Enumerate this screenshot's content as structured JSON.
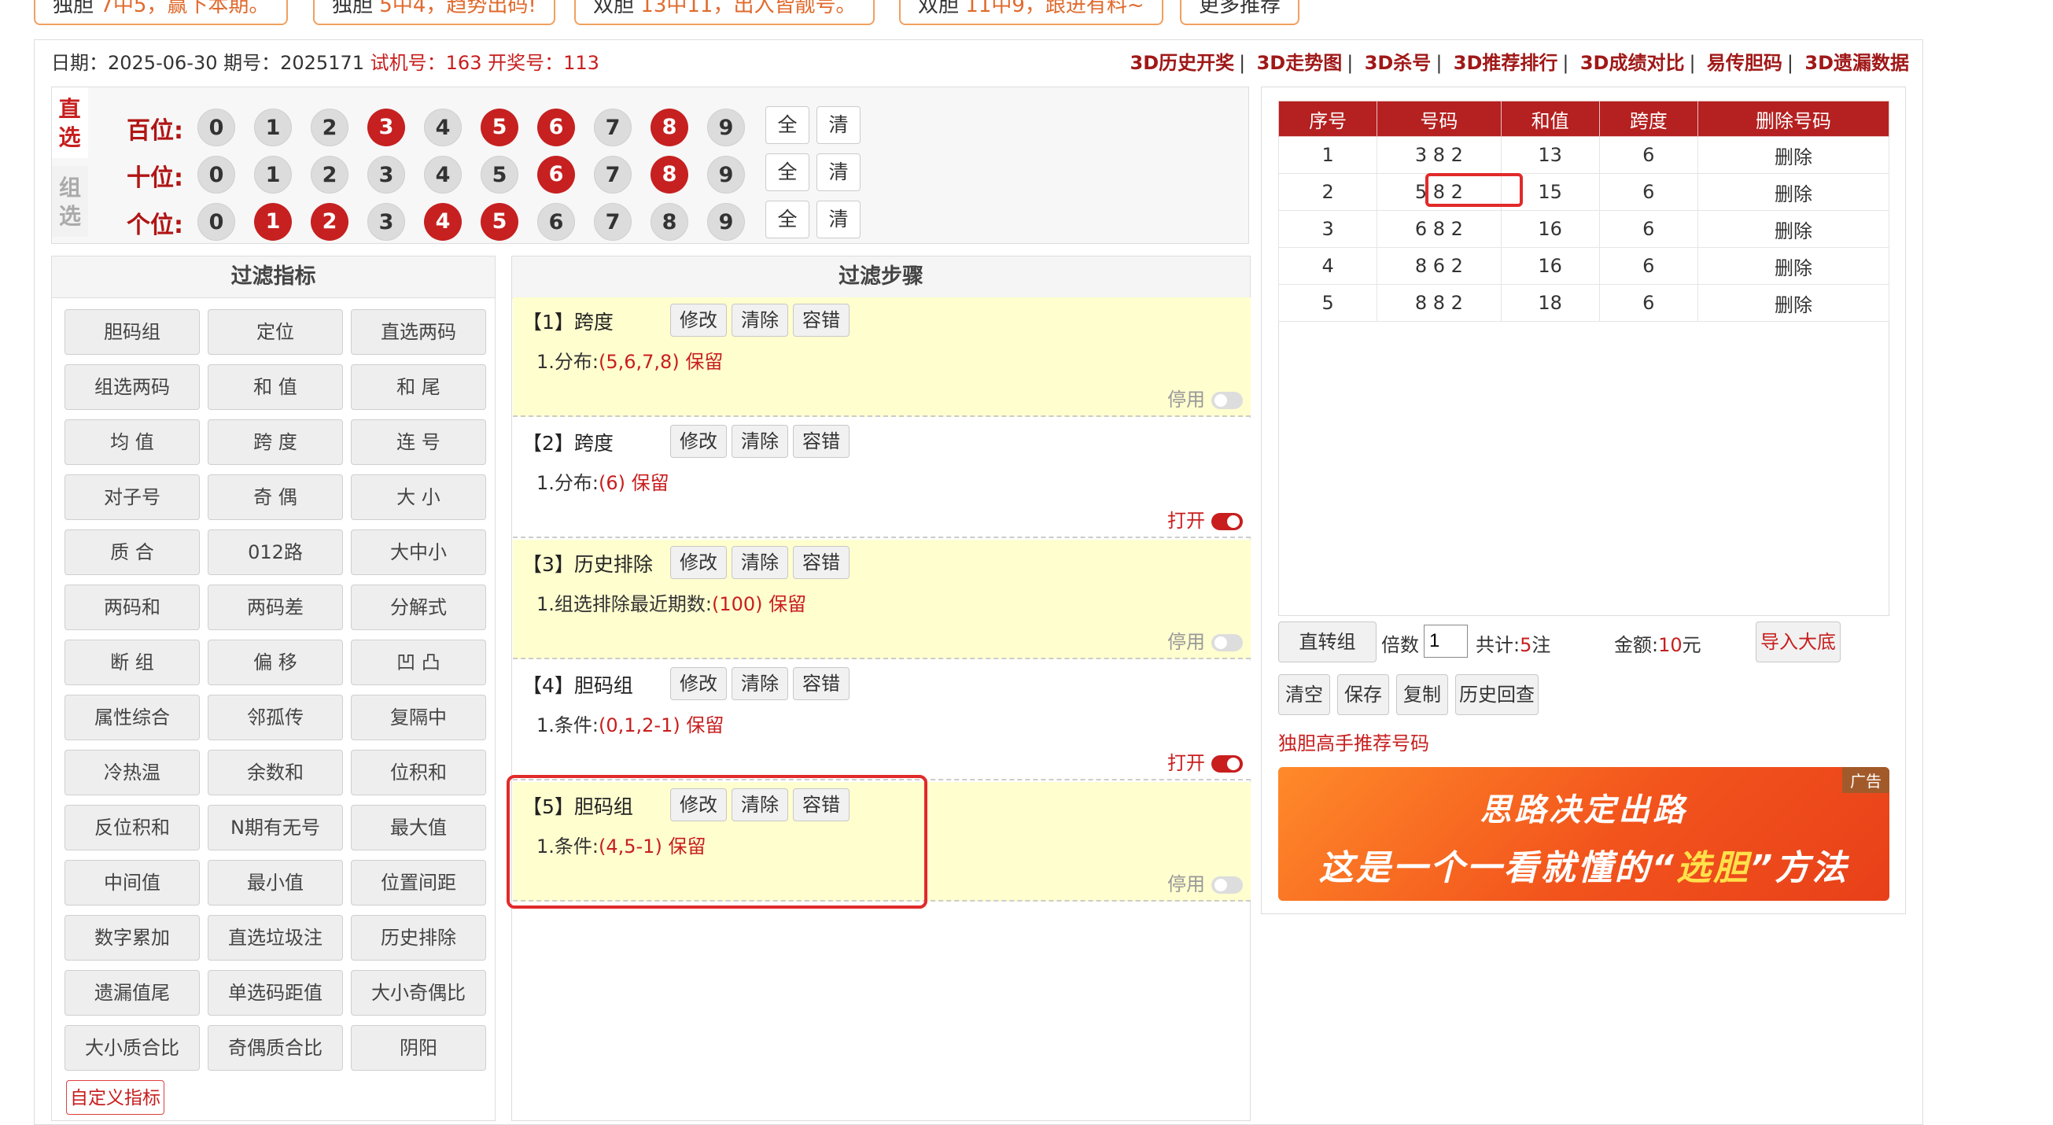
{
  "promos": [
    {
      "tag": "独胆",
      "text": "7中5，赢下本期。"
    },
    {
      "tag": "独胆",
      "text": "5中4，趋势出码!"
    },
    {
      "tag": "双胆",
      "text": "13中11，出入皆靓号。"
    },
    {
      "tag": "双胆",
      "text": "11中9，跟进有料~"
    },
    {
      "tag": "",
      "text": "更多推荐"
    }
  ],
  "info": {
    "date_label": "日期：",
    "date": "2025-06-30",
    "issue_label": "期号：",
    "issue": "2025171",
    "trial_label": "试机号：",
    "trial": "163",
    "draw_label": "开奖号：",
    "draw": "113"
  },
  "top_links": [
    "3D历史开奖",
    "3D走势图",
    "3D杀号",
    "3D推荐排行",
    "3D成绩对比",
    "易传胆码",
    "3D遗漏数据"
  ],
  "picker": {
    "mode_active": "直选",
    "mode_inactive": "组选",
    "rows": [
      {
        "label": "百位:",
        "selected": [
          3,
          5,
          6,
          8
        ]
      },
      {
        "label": "十位:",
        "selected": [
          6,
          8
        ]
      },
      {
        "label": "个位:",
        "selected": [
          1,
          2,
          4,
          5
        ]
      }
    ],
    "digits": [
      "0",
      "1",
      "2",
      "3",
      "4",
      "5",
      "6",
      "7",
      "8",
      "9"
    ],
    "all_label": "全",
    "clear_label": "清"
  },
  "filter_panel": {
    "title": "过滤指标",
    "items": [
      "胆码组",
      "定位",
      "直选两码",
      "组选两码",
      "和 值",
      "和 尾",
      "均 值",
      "跨 度",
      "连 号",
      "对子号",
      "奇 偶",
      "大 小",
      "质 合",
      "012路",
      "大中小",
      "两码和",
      "两码差",
      "分解式",
      "断 组",
      "偏 移",
      "凹 凸",
      "属性综合",
      "邻孤传",
      "复隔中",
      "冷热温",
      "余数和",
      "位积和",
      "反位积和",
      "N期有无号",
      "最大值",
      "中间值",
      "最小值",
      "位置间距",
      "数字累加",
      "直选垃圾注",
      "历史排除",
      "遗漏值尾",
      "单选码距值",
      "大小奇偶比",
      "大小质合比",
      "奇偶质合比",
      "阴阳"
    ],
    "custom_label": "自定义指标"
  },
  "steps_panel": {
    "title": "过滤步骤",
    "buttons": [
      "修改",
      "清除",
      "容错"
    ],
    "steps": [
      {
        "title": "【1】跨度",
        "cond_prefix": "1.分布:",
        "cond_value": "(5,6,7,8)",
        "cond_action": "保留",
        "state": "停用",
        "on": false
      },
      {
        "title": "【2】跨度",
        "cond_prefix": "1.分布:",
        "cond_value": "(6)",
        "cond_action": "保留",
        "state": "打开",
        "on": true
      },
      {
        "title": "【3】历史排除",
        "cond_prefix": "1.组选排除最近期数:",
        "cond_value": "(100)",
        "cond_action": "保留",
        "state": "停用",
        "on": false
      },
      {
        "title": "【4】胆码组",
        "cond_prefix": "1.条件:",
        "cond_value": "(0,1,2-1)",
        "cond_action": "保留",
        "state": "打开",
        "on": true
      },
      {
        "title": "【5】胆码组",
        "cond_prefix": "1.条件:",
        "cond_value": "(4,5-1)",
        "cond_action": "保留",
        "state": "停用",
        "on": false
      }
    ]
  },
  "results": {
    "columns": [
      "序号",
      "号码",
      "和值",
      "跨度",
      "删除号码"
    ],
    "rows": [
      [
        "1",
        "3 8 2",
        "13",
        "6",
        "删除"
      ],
      [
        "2",
        "5 8 2",
        "15",
        "6",
        "删除"
      ],
      [
        "3",
        "6 8 2",
        "16",
        "6",
        "删除"
      ],
      [
        "4",
        "8 6 2",
        "16",
        "6",
        "删除"
      ],
      [
        "5",
        "8 8 2",
        "18",
        "6",
        "删除"
      ]
    ],
    "to_group_label": "直转组",
    "multiple_label": "倍数",
    "multiple_value": "1",
    "total_label": "共计:",
    "total_value": "5",
    "total_unit": "注",
    "amount_label": "金额:",
    "amount_value": "10",
    "amount_unit": "元",
    "import_label": "导入大底",
    "actions": [
      "清空",
      "保存",
      "复制",
      "历史回查"
    ],
    "recommend_label": "独胆高手推荐号码"
  },
  "ad": {
    "line1": "思路决定出路",
    "line2_pre": "这是一个一看就懂的“",
    "line2_hl": "选胆",
    "line2_post": "”方法",
    "badge": "广告"
  },
  "colors": {
    "accent": "#c81e1e",
    "header_red": "#b52020",
    "step_yellow": "#fffecf"
  }
}
